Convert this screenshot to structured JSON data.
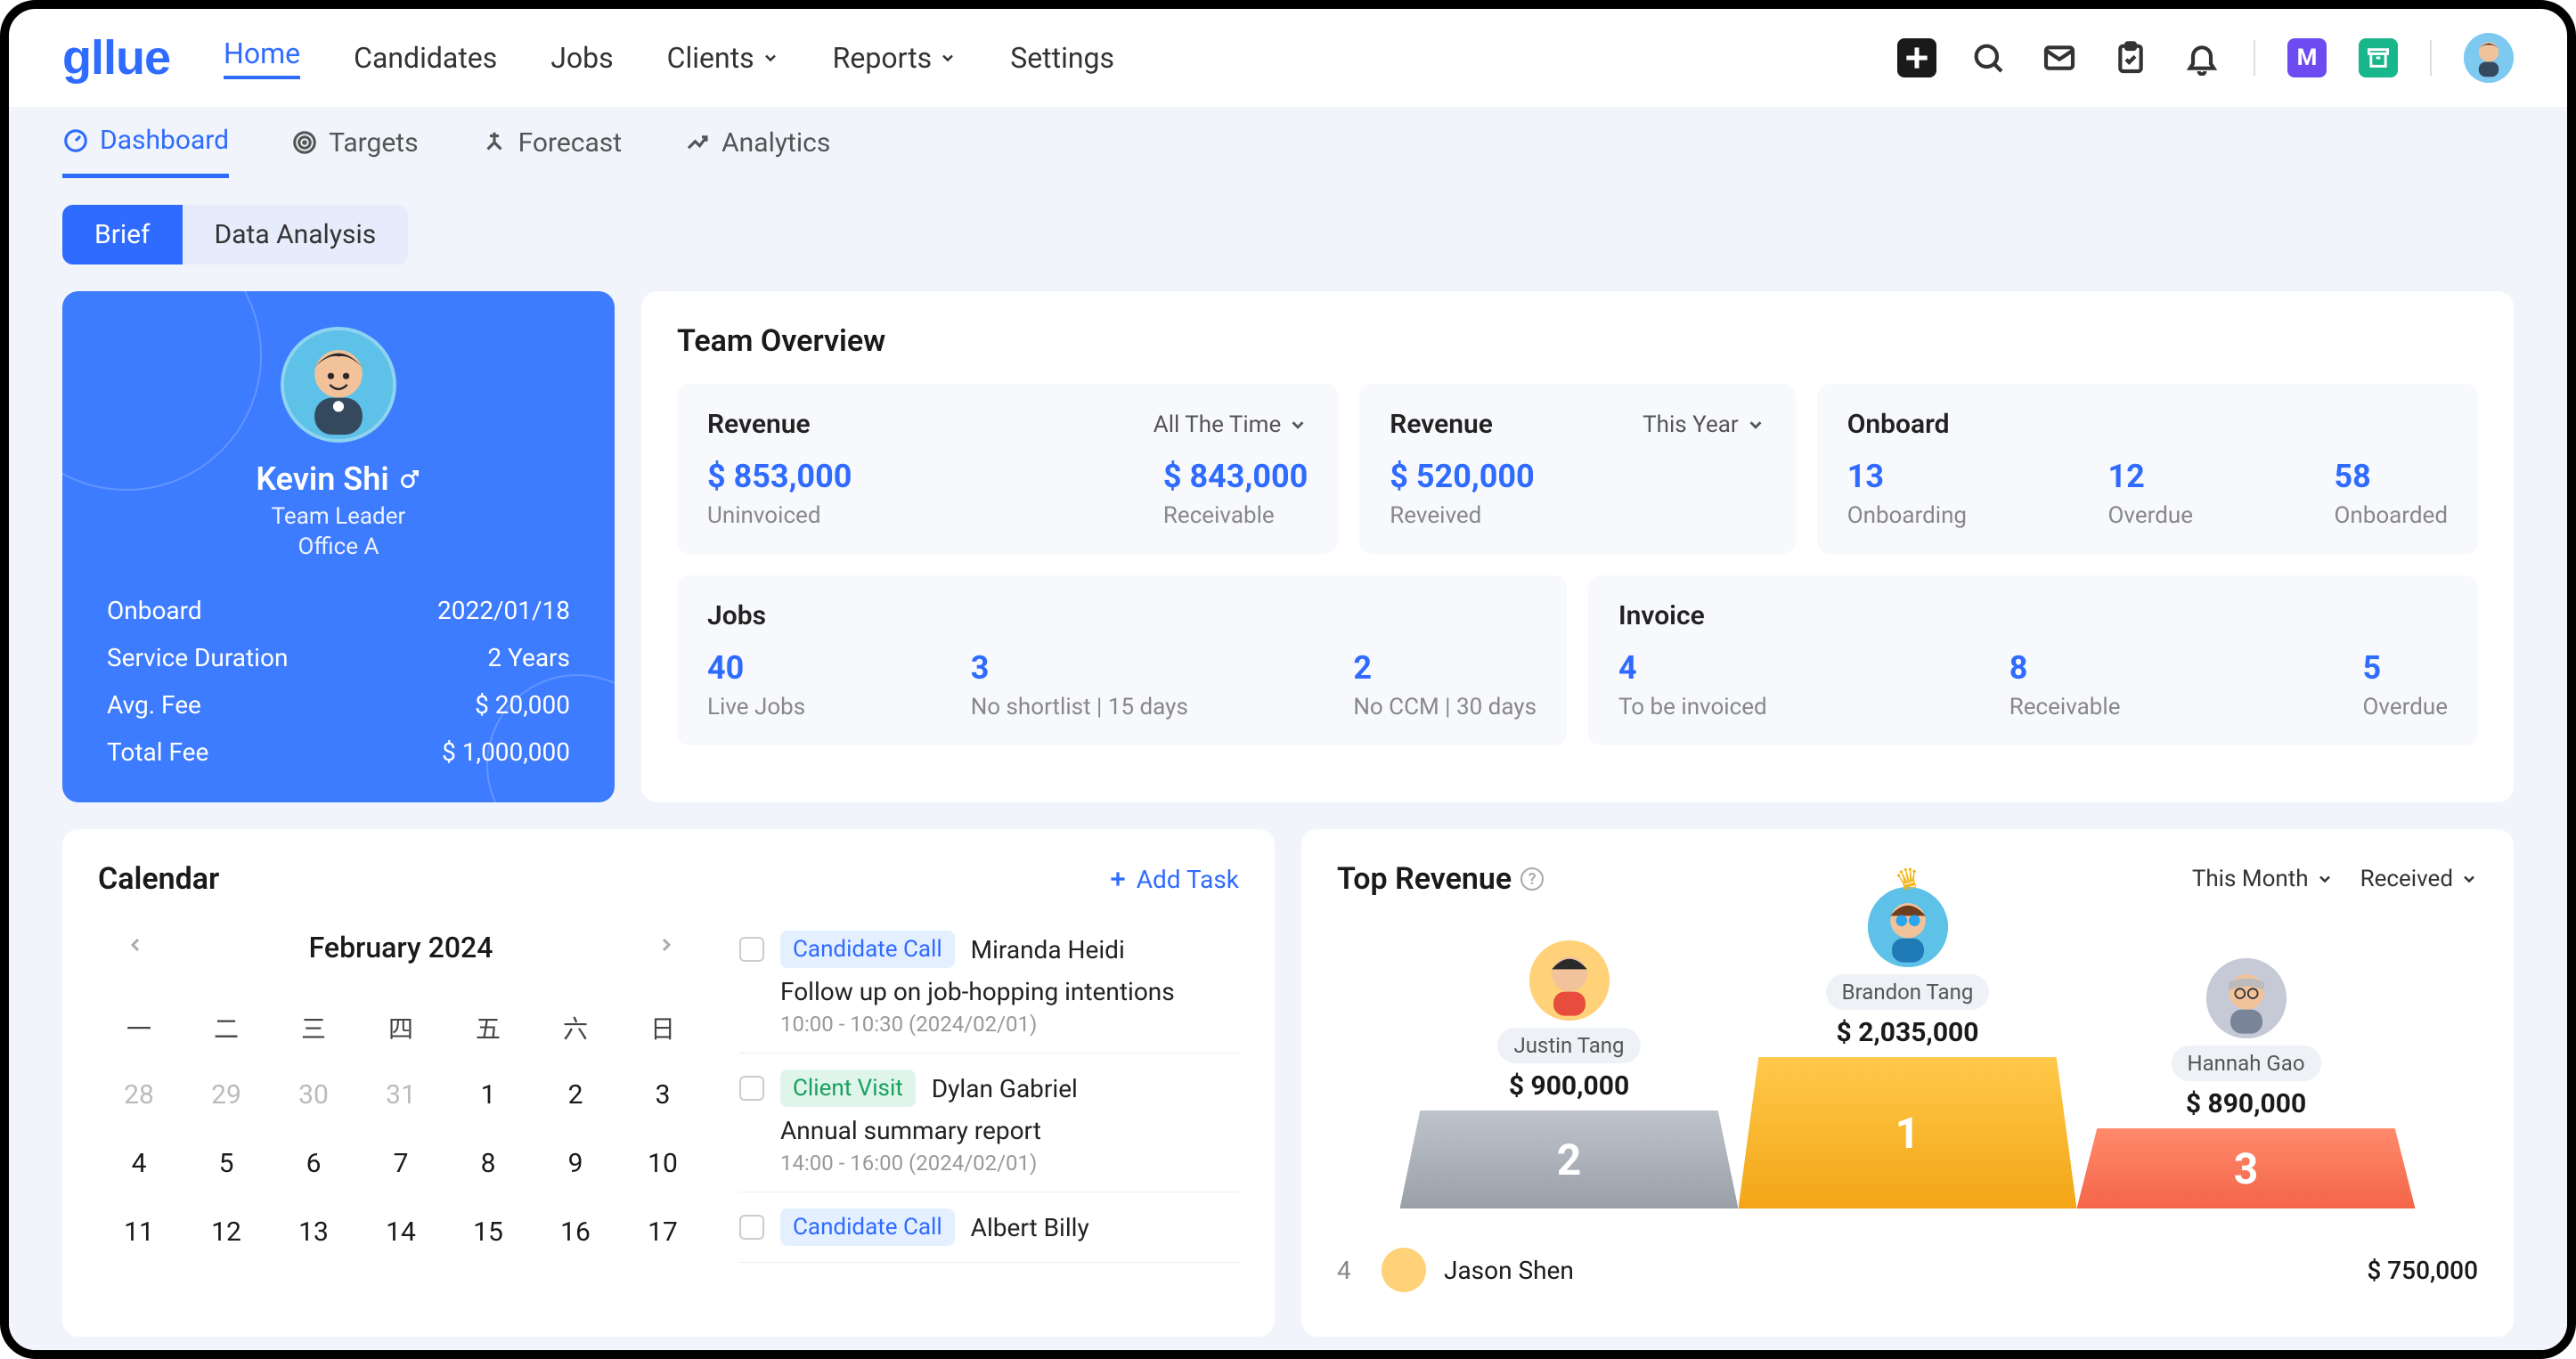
{
  "brand": "gllue",
  "nav": {
    "home": "Home",
    "candidates": "Candidates",
    "jobs": "Jobs",
    "clients": "Clients",
    "reports": "Reports",
    "settings": "Settings"
  },
  "subnav": {
    "dashboard": "Dashboard",
    "targets": "Targets",
    "forecast": "Forecast",
    "analytics": "Analytics"
  },
  "pill_tabs": {
    "brief": "Brief",
    "data_analysis": "Data Analysis"
  },
  "profile": {
    "name": "Kevin Shi",
    "role": "Team Leader",
    "office": "Office A",
    "stats": {
      "onboard_label": "Onboard",
      "onboard_value": "2022/01/18",
      "duration_label": "Service Duration",
      "duration_value": "2 Years",
      "avgfee_label": "Avg. Fee",
      "avgfee_value": "$ 20,000",
      "totalfee_label": "Total Fee",
      "totalfee_value": "$ 1,000,000"
    }
  },
  "team": {
    "title": "Team Overview",
    "revenue1": {
      "title": "Revenue",
      "filter": "All The Time",
      "v1": "$ 853,000",
      "l1": "Uninvoiced",
      "v2": "$ 843,000",
      "l2": "Receivable"
    },
    "revenue2": {
      "title": "Revenue",
      "filter": "This Year",
      "v1": "$ 520,000",
      "l1": "Reveived"
    },
    "onboard": {
      "title": "Onboard",
      "v1": "13",
      "l1": "Onboarding",
      "v2": "12",
      "l2": "Overdue",
      "v3": "58",
      "l3": "Onboarded"
    },
    "jobs": {
      "title": "Jobs",
      "v1": "40",
      "l1": "Live Jobs",
      "v2": "3",
      "l2": "No shortlist | 15 days",
      "v3": "2",
      "l3": "No CCM | 30 days"
    },
    "invoice": {
      "title": "Invoice",
      "v1": "4",
      "l1": "To be invoiced",
      "v2": "8",
      "l2": "Receivable",
      "v3": "5",
      "l3": "Overdue"
    }
  },
  "calendar": {
    "title": "Calendar",
    "add_task": "Add Task",
    "month": "February 2024",
    "dow": [
      "一",
      "二",
      "三",
      "四",
      "五",
      "六",
      "日"
    ],
    "days_muted": [
      "28",
      "29",
      "30",
      "31"
    ],
    "days": [
      "1",
      "2",
      "3",
      "4",
      "5",
      "6",
      "7",
      "8",
      "9",
      "10",
      "11",
      "12",
      "13",
      "14",
      "15",
      "16",
      "17"
    ],
    "tasks": [
      {
        "tag": "Candidate Call",
        "tag_color": "blue",
        "person": "Miranda Heidi",
        "desc": "Follow up on job-hopping intentions",
        "time": "10:00 - 10:30 (2024/02/01)"
      },
      {
        "tag": "Client Visit",
        "tag_color": "green",
        "person": "Dylan Gabriel",
        "desc": "Annual summary report",
        "time": "14:00 - 16:00 (2024/02/01)"
      },
      {
        "tag": "Candidate Call",
        "tag_color": "blue",
        "person": "Albert Billy",
        "desc": "",
        "time": ""
      }
    ]
  },
  "top_revenue": {
    "title": "Top Revenue",
    "filter1": "This Month",
    "filter2": "Received",
    "podium": {
      "p1_name": "Brandon Tang",
      "p1_amount": "$ 2,035,000",
      "p1_rank": "1",
      "p2_name": "Justin Tang",
      "p2_amount": "$ 900,000",
      "p2_rank": "2",
      "p3_name": "Hannah Gao",
      "p3_amount": "$ 890,000",
      "p3_rank": "3"
    },
    "list": [
      {
        "rank": "4",
        "name": "Jason Shen",
        "amount": "$  750,000"
      }
    ]
  },
  "badge_m": "M"
}
